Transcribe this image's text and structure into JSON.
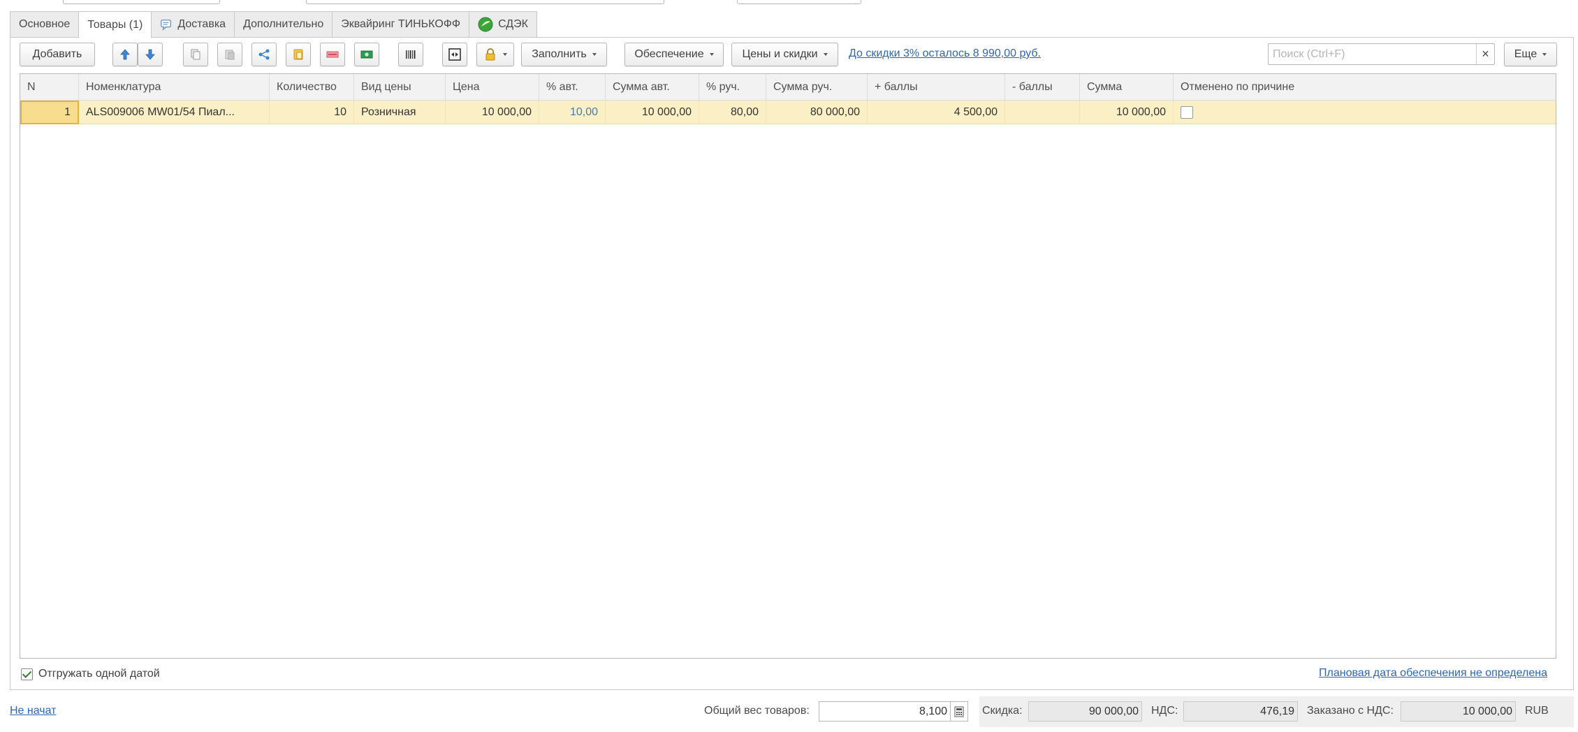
{
  "tabs": [
    {
      "label": "Основное",
      "icon": null,
      "active": false
    },
    {
      "label": "Товары (1)",
      "icon": null,
      "active": true
    },
    {
      "label": "Доставка",
      "icon": "speech-bubble-icon",
      "active": false
    },
    {
      "label": "Дополнительно",
      "icon": null,
      "active": false
    },
    {
      "label": "Эквайринг ТИНЬКОФФ",
      "icon": null,
      "active": false
    },
    {
      "label": "СДЭК",
      "icon": "green-play-icon",
      "active": false
    }
  ],
  "toolbar": {
    "add_label": "Добавить",
    "fill_label": "Заполнить",
    "supply_label": "Обеспечение",
    "prices_label": "Цены и скидки",
    "discount_link": "До скидки 3% осталось 8 990,00 руб.",
    "more_label": "Еще",
    "icons": [
      "arrow-up-icon",
      "arrow-down-icon",
      "copy-icon",
      "paste-icon",
      "split-icon",
      "paste-special-icon",
      "cancel-rows-icon",
      "pricing-icon",
      "barcode-icon",
      "expand-icon",
      "lock-icon"
    ]
  },
  "search": {
    "placeholder": "Поиск (Ctrl+F)",
    "value": "",
    "clear_icon": "×"
  },
  "table": {
    "columns": [
      "N",
      "Номенклатура",
      "Количество",
      "Вид цены",
      "Цена",
      "% авт.",
      "Сумма авт.",
      "% руч.",
      "Сумма руч.",
      "+ баллы",
      "- баллы",
      "Сумма",
      "Отменено по причине"
    ],
    "rows": [
      {
        "n": "1",
        "item": "ALS009006    MW01/54   Пиал...",
        "qty": "10",
        "price_type": "Розничная",
        "price": "10 000,00",
        "pct_auto": "10,00",
        "sum_auto": "10 000,00",
        "pct_manual": "80,00",
        "sum_manual": "80 000,00",
        "points_plus": "4 500,00",
        "points_minus": "",
        "sum": "10 000,00",
        "cancelled": false
      }
    ]
  },
  "footer": {
    "ship_one_date_label": "Отгружать одной датой",
    "ship_one_date_checked": true,
    "plan_date_link": "Плановая дата обеспечения не определена",
    "status_link": "Не начат",
    "weight_label": "Общий вес товаров:",
    "weight_value": "8,100",
    "discount_label": "Скидка:",
    "discount_value": "90 000,00",
    "vat_label": "НДС:",
    "vat_value": "476,19",
    "ordered_label": "Заказано с НДС:",
    "ordered_value": "10 000,00",
    "currency": "RUB"
  }
}
